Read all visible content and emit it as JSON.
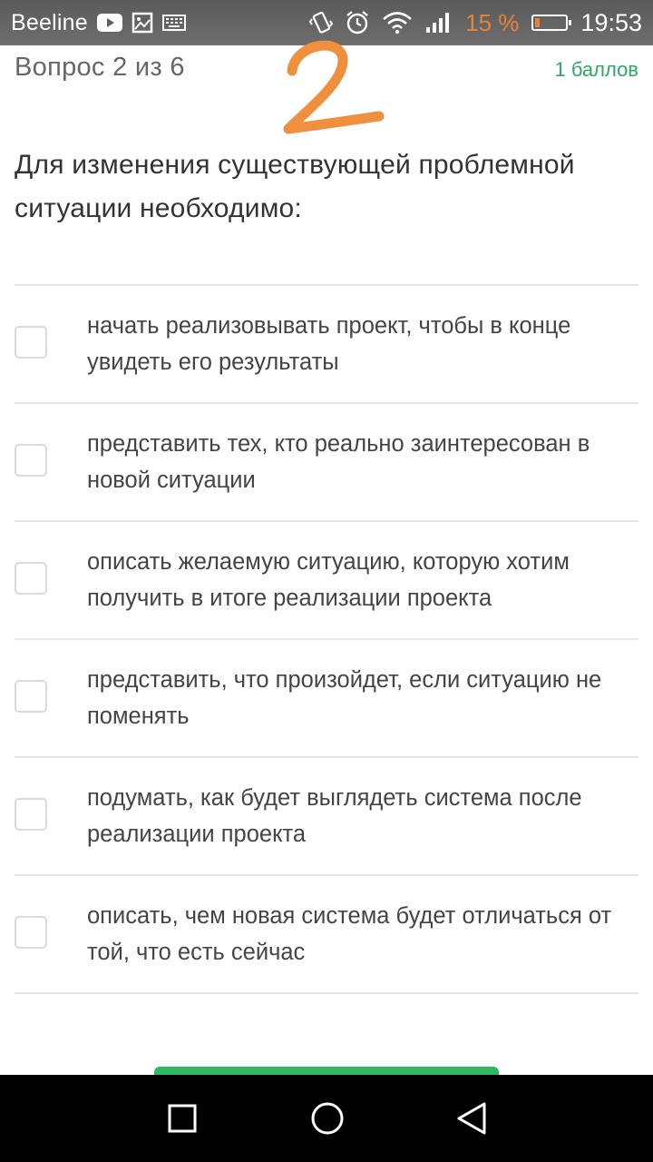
{
  "status_bar": {
    "carrier": "Beeline",
    "battery_percent": "15 %",
    "battery_level": 0.15,
    "time": "19:53",
    "icons": [
      "youtube-icon",
      "image-icon",
      "keyboard-icon",
      "vibrate-icon",
      "alarm-icon",
      "wifi-icon",
      "signal-icon",
      "battery-icon"
    ],
    "battery_color": "#e8823a"
  },
  "header": {
    "question_counter": "Вопрос 2 из 6",
    "points": "1 баллов",
    "points_color": "#2ea865",
    "annotation_glyph": "2",
    "annotation_color": "#f0903f"
  },
  "question": {
    "text": "Для изменения существующей проблемной ситуации необходимо:"
  },
  "options": [
    {
      "label": "начать реализовывать проект, чтобы в конце увидеть его результаты",
      "checked": false
    },
    {
      "label": "представить тех, кто реально заинтересован в новой ситуации",
      "checked": false
    },
    {
      "label": "описать желаемую ситуацию, которую хотим получить в итоге реализации проекта",
      "checked": false
    },
    {
      "label": "представить, что произойдет, если ситуацию не поменять",
      "checked": false
    },
    {
      "label": "подумать, как будет выглядеть система после реализации проекта",
      "checked": false
    },
    {
      "label": "описать, чем новая система будет отличаться от той, что есть сейчас",
      "checked": false
    }
  ],
  "submit_button": {
    "color": "#2bb964"
  },
  "nav_bar": {
    "buttons": [
      "recent-apps-icon",
      "home-icon",
      "back-icon"
    ]
  }
}
